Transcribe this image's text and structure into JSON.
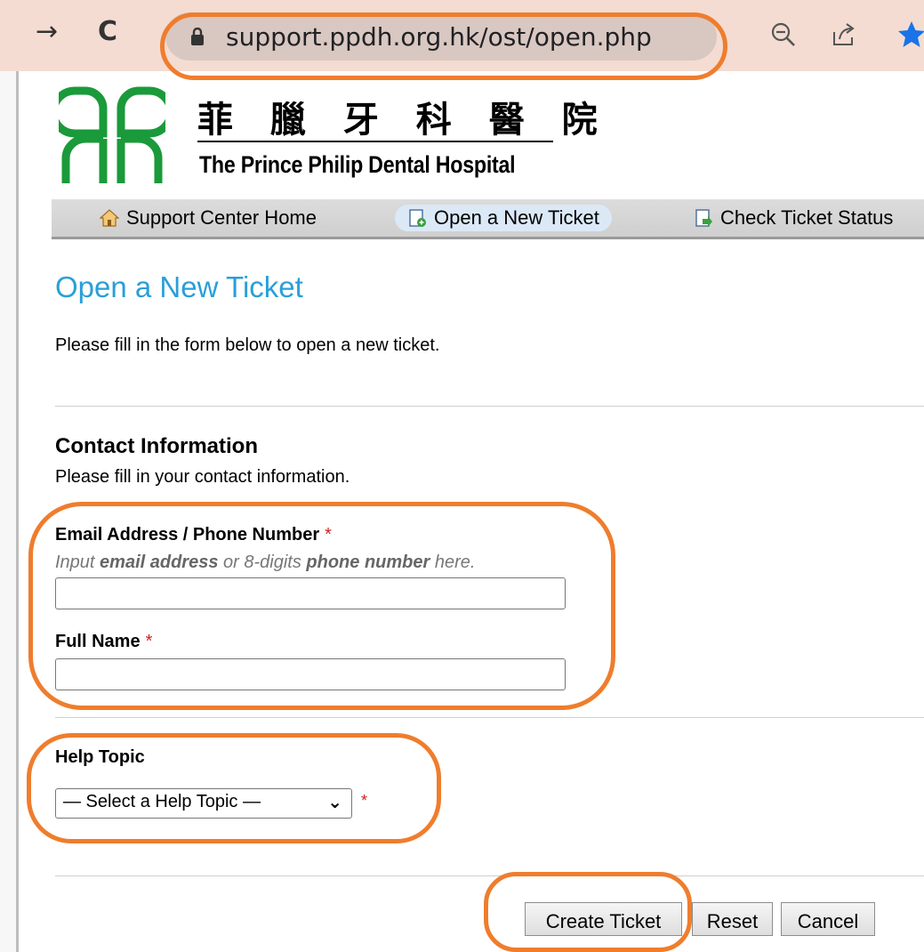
{
  "browser": {
    "url": "support.ppdh.org.hk/ost/open.php",
    "back_icon": "back-arrow-icon",
    "reload_icon": "reload-icon"
  },
  "logo": {
    "chinese_name": "菲 臘 牙 科 醫 院",
    "english_name": "The Prince Philip Dental Hospital",
    "brand_color": "#1a9a3a"
  },
  "nav": {
    "items": [
      {
        "label": "Support Center Home",
        "icon": "home-icon"
      },
      {
        "label": "Open a New Ticket",
        "icon": "new-ticket-icon"
      },
      {
        "label": "Check Ticket Status",
        "icon": "ticket-status-icon"
      }
    ]
  },
  "page": {
    "title": "Open a New Ticket",
    "intro": "Please fill in the form below to open a new ticket."
  },
  "contact": {
    "title": "Contact Information",
    "description": "Please fill in your contact information.",
    "email_label": "Email Address / Phone Number",
    "email_hint_1": "Input ",
    "email_hint_2": "email address",
    "email_hint_3": " or 8-digits ",
    "email_hint_4": "phone number",
    "email_hint_5": " here.",
    "email_value": "",
    "fullname_label": "Full Name",
    "fullname_value": "",
    "required_mark": "*"
  },
  "help_topic": {
    "label": "Help Topic",
    "selected": "— Select a Help Topic —",
    "required_mark": "*"
  },
  "buttons": {
    "create": "Create Ticket",
    "reset": "Reset",
    "cancel": "Cancel"
  },
  "colors": {
    "accent": "#2a9fd8",
    "annotation": "#ef7d2d",
    "required": "#d02020"
  }
}
